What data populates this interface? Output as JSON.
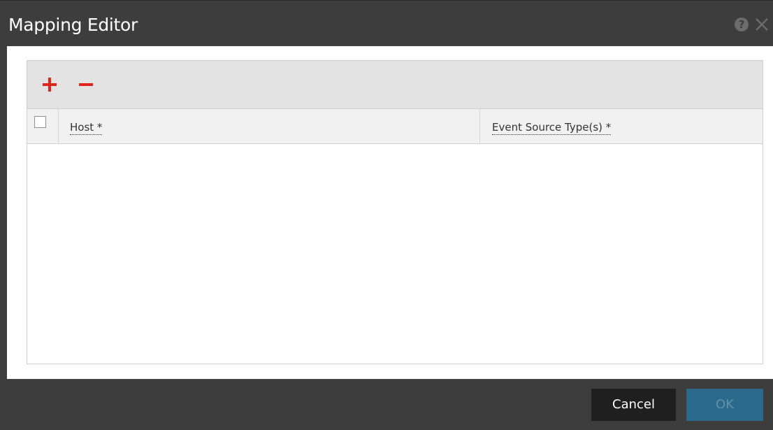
{
  "window": {
    "title": "Mapping Editor",
    "help_icon": "help-icon",
    "close_icon": "close-icon"
  },
  "toolbar": {
    "add_icon": "plus-icon",
    "remove_icon": "minus-icon",
    "accent_color": "#e0231b"
  },
  "grid": {
    "columns": [
      {
        "key": "select",
        "label": ""
      },
      {
        "key": "host",
        "label": "Host *"
      },
      {
        "key": "event_source_types",
        "label": "Event Source Type(s) *"
      }
    ],
    "rows": []
  },
  "footer": {
    "cancel_label": "Cancel",
    "ok_label": "OK"
  }
}
